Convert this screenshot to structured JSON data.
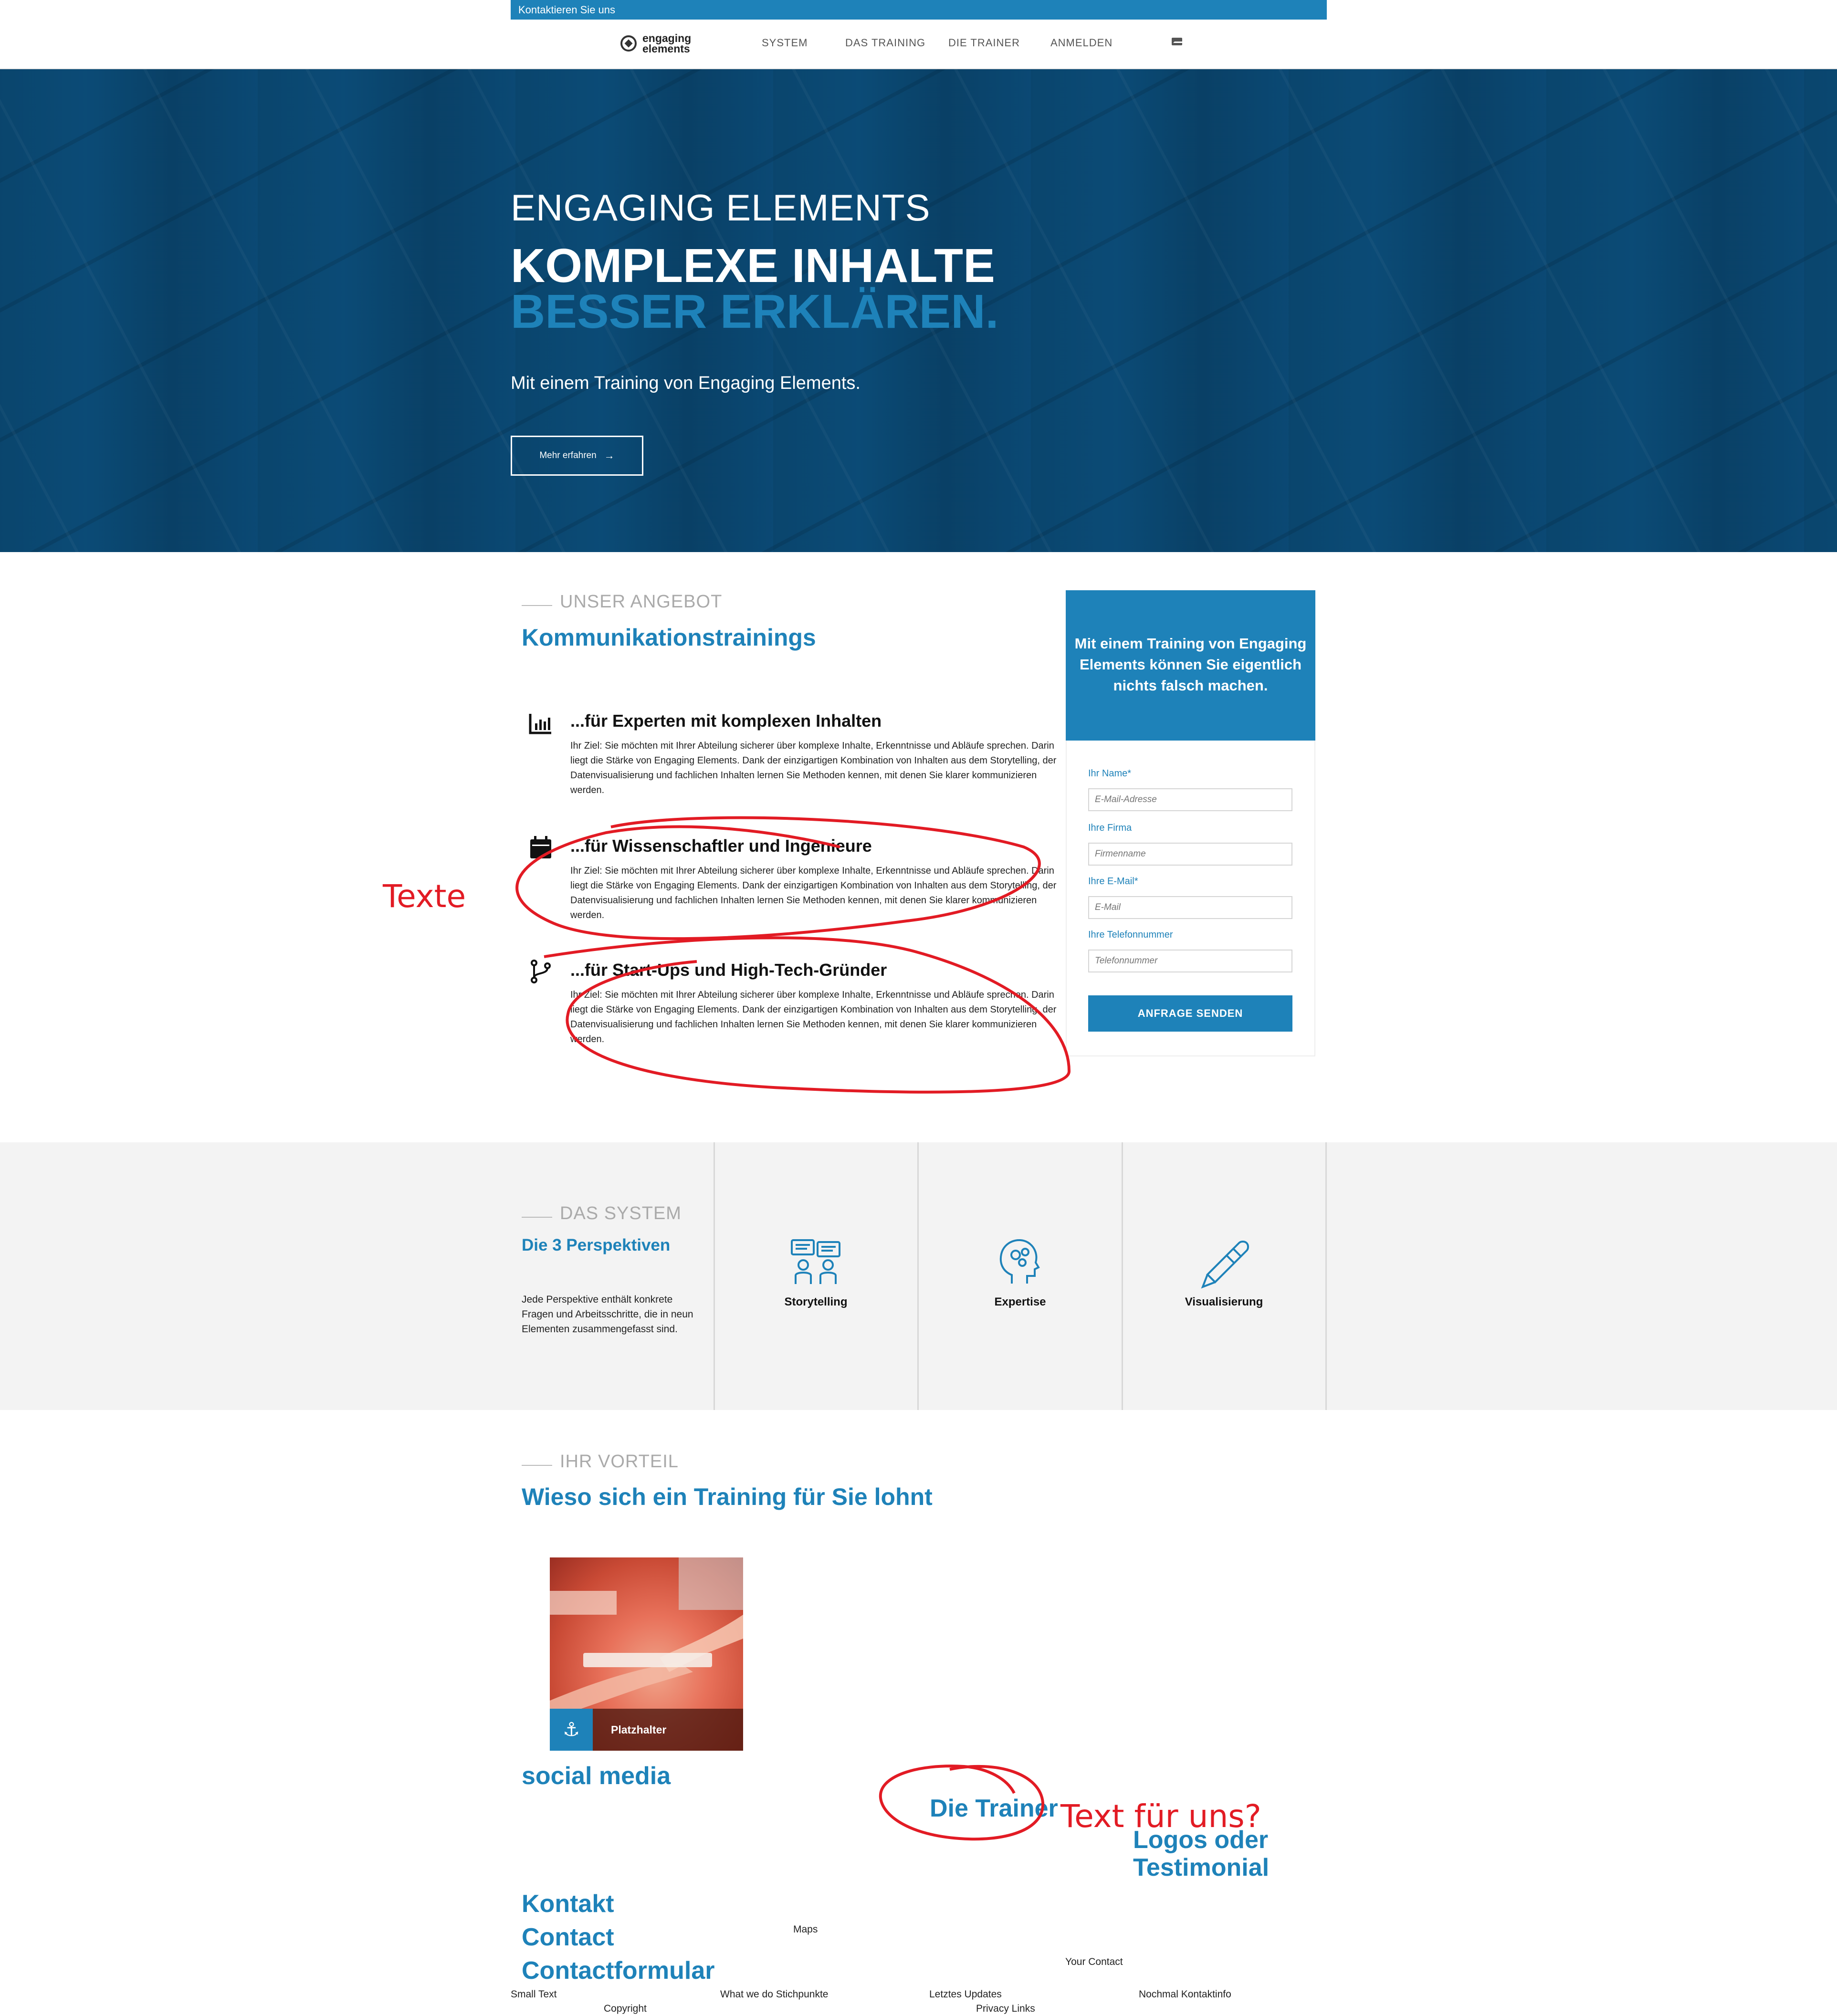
{
  "topbar": {
    "contact": "Kontaktieren Sie uns"
  },
  "nav": {
    "logo_line1": "engaging",
    "logo_line2": "elements",
    "items": [
      "SYSTEM",
      "DAS TRAINING",
      "DIE TRAINER",
      "ANMELDEN"
    ]
  },
  "hero": {
    "eyebrow": "ENGAGING ELEMENTS",
    "title_line1": "KOMPLEXE INHALTE",
    "title_line2": "BESSER ERKLÄREN.",
    "subtitle": "Mit einem Training von Engaging Elements.",
    "button": "Mehr erfahren"
  },
  "offer": {
    "eyebrow": "UNSER ANGEBOT",
    "title": "Kommunikationstrainings",
    "features": [
      {
        "icon": "bar-chart-icon",
        "title": "...für Experten mit komplexen Inhalten",
        "text": "Ihr Ziel: Sie möchten mit Ihrer Abteilung sicherer über komplexe Inhalte, Erkenntnisse und Abläufe sprechen. Darin liegt die Stärke von Engaging Elements. Dank der einzigartigen Kombination von Inhalten aus dem Storytelling, der Datenvisualisierung und fachlichen Inhalten lernen Sie Methoden kennen, mit denen Sie klarer kommunizieren werden."
      },
      {
        "icon": "calendar-icon",
        "title": "...für Wissenschaftler und Ingenieure",
        "text": "Ihr Ziel: Sie möchten mit Ihrer Abteilung sicherer über komplexe Inhalte, Erkenntnisse und Abläufe sprechen. Darin liegt die Stärke von Engaging Elements. Dank der einzigartigen Kombination von Inhalten aus dem Storytelling, der Datenvisualisierung und fachlichen Inhalten lernen Sie Methoden kennen, mit denen Sie klarer kommunizieren werden."
      },
      {
        "icon": "git-branch-icon",
        "title": "...für Start-Ups und High-Tech-Gründer",
        "text": "Ihr Ziel: Sie möchten mit Ihrer Abteilung sicherer über komplexe Inhalte, Erkenntnisse und Abläufe sprechen. Darin liegt die Stärke von Engaging Elements. Dank der einzigartigen Kombination von Inhalten aus dem Storytelling, der Datenvisualisierung und fachlichen Inhalten lernen Sie Methoden kennen, mit denen Sie klarer kommunizieren werden."
      }
    ]
  },
  "form": {
    "heading": "Mit einem Training von Engaging Elements können Sie eigentlich nichts falsch machen.",
    "name_label": "Ihr Name*",
    "name_placeholder": "E-Mail-Adresse",
    "company_label": "Ihre Firma",
    "company_placeholder": "Firmenname",
    "email_label": "Ihre E-Mail*",
    "email_placeholder": "E-Mail",
    "phone_label": "Ihre Telefonnummer",
    "phone_placeholder": "Telefonnummer",
    "submit": "ANFRAGE SENDEN"
  },
  "system": {
    "eyebrow": "DAS SYSTEM",
    "title": "Die 3 Perspektiven",
    "text": "Jede Perspektive enthält konkrete Fragen und Arbeitsschritte, die in neun Elementen zusammengefasst sind.",
    "items": [
      {
        "icon": "storytelling-icon",
        "label": "Storytelling"
      },
      {
        "icon": "head-gears-icon",
        "label": "Expertise"
      },
      {
        "icon": "pen-icon",
        "label": "Visualisierung"
      }
    ]
  },
  "advantage": {
    "eyebrow": "IHR VORTEIL",
    "title": "Wieso sich ein Training für Sie lohnt",
    "image_caption": "Platzhalter",
    "image_icon": "anchor-icon"
  },
  "lower": {
    "social": "social media",
    "trainer": "Die Trainer",
    "logos_line1": "Logos oder",
    "logos_line2": "Testimonial",
    "kontakt": "Kontakt",
    "contact": "Contact",
    "contactform": "Contactformular",
    "maps": "Maps",
    "your_contact": "Your Contact"
  },
  "footer": {
    "small_text": "Small Text",
    "copyright": "Copyright",
    "what_we_do": "What we do Stichpunkte",
    "updates": "Letztes Updates",
    "privacy": "Privacy Links",
    "contact_info": "Nochmal Kontaktinfo"
  },
  "annotations": {
    "texte": "Texte",
    "text_fuer_uns": "Text für uns?"
  },
  "colors": {
    "accent": "#1e82b9",
    "annotation": "#e21b24",
    "hero_bg": "#0b4a73"
  }
}
